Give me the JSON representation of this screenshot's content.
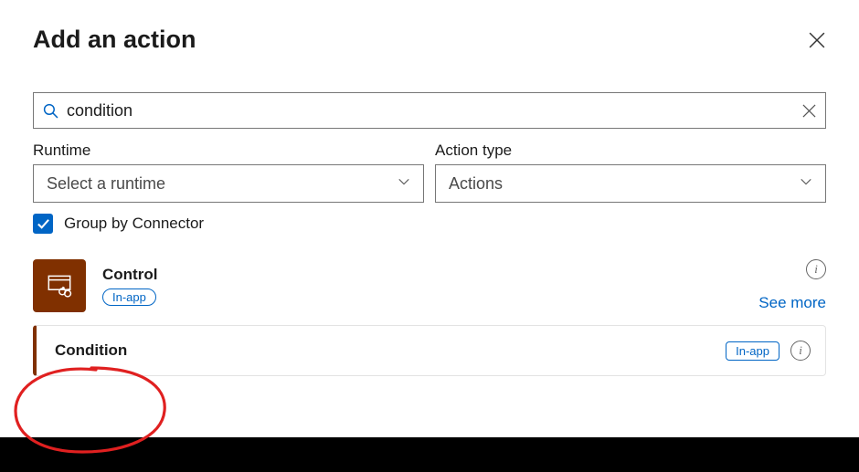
{
  "header": {
    "title": "Add an action"
  },
  "search": {
    "value": "condition"
  },
  "filters": {
    "runtime": {
      "label": "Runtime",
      "selected": "Select a runtime"
    },
    "actionType": {
      "label": "Action type",
      "selected": "Actions"
    }
  },
  "groupByConnector": {
    "label": "Group by Connector",
    "checked": true
  },
  "connector": {
    "name": "Control",
    "badge": "In-app",
    "seeMore": "See more"
  },
  "action": {
    "name": "Condition",
    "badge": "In-app"
  },
  "colors": {
    "accent": "#0065c5",
    "brand": "#803000"
  }
}
